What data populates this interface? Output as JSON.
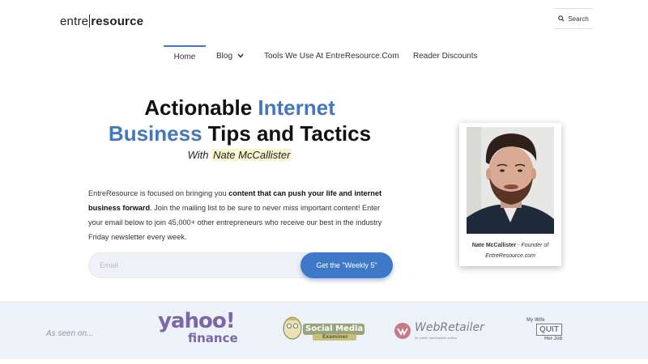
{
  "header": {
    "logo_part1": "entre",
    "logo_part2": "resource",
    "search_label": "Search"
  },
  "nav": {
    "items": [
      {
        "label": "Home"
      },
      {
        "label": "Blog"
      },
      {
        "label": "Tools We Use At EntreResource.Com"
      },
      {
        "label": "Reader Discounts"
      }
    ]
  },
  "hero": {
    "title_part1": "Actionable ",
    "title_part2": "Internet",
    "title_part3": "Business",
    "title_part4": " Tips and Tactics",
    "subtitle_prefix": "With ",
    "subtitle_name": "Nate McCallister",
    "desc_part1": "EntreResource is focused on bringing you ",
    "desc_bold": "content that can push your life and internet business forward",
    "desc_part2": ". Join the mailing list to be sure to never miss important content! Enter your email below to join 45,000+ other entrepreneurs who receive our best in the industry Friday newsletter every week.",
    "email_placeholder": "Email",
    "cta_label": "Get the \"Weekly 5\""
  },
  "profile": {
    "name": "Nate McCallister",
    "role": " - Founder of",
    "site": "EntreResource.com"
  },
  "press": {
    "label": "As seen on...",
    "logos": {
      "yahoo_top": "yahoo!",
      "yahoo_bottom": "finance",
      "socialmedia_top": "Social Media",
      "socialmedia_bottom": "Examiner",
      "webretailer": "WebRetailer",
      "webretailer_tag": "for online marketplace sellers",
      "wife_top": "My Wife",
      "wife_mid": "QUIT",
      "wife_bottom": "Her Job"
    }
  },
  "colors": {
    "accent_blue": "#4378bf",
    "cta_blue": "#3e78c8",
    "band_bg": "#edf2f9",
    "highlight": "#fbf5d2"
  }
}
